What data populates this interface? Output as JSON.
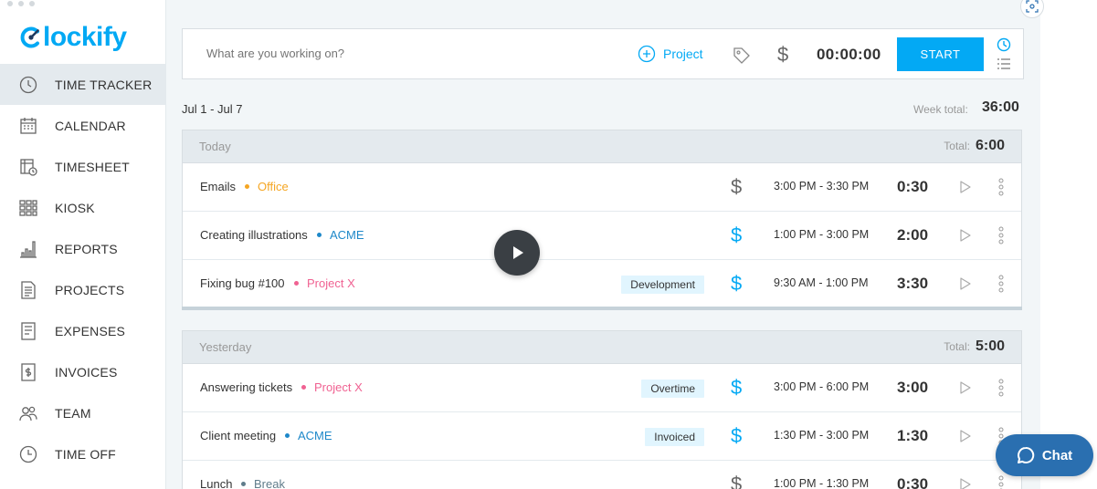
{
  "app": {
    "logo_text": "lockify",
    "brand_color": "#03a9f4"
  },
  "sidebar": {
    "items": [
      {
        "label": "TIME TRACKER",
        "icon": "clock-icon",
        "active": true
      },
      {
        "label": "CALENDAR",
        "icon": "calendar-icon",
        "active": false
      },
      {
        "label": "TIMESHEET",
        "icon": "timesheet-icon",
        "active": false
      },
      {
        "label": "KIOSK",
        "icon": "kiosk-icon",
        "active": false
      },
      {
        "label": "REPORTS",
        "icon": "reports-icon",
        "active": false
      },
      {
        "label": "PROJECTS",
        "icon": "projects-icon",
        "active": false
      },
      {
        "label": "EXPENSES",
        "icon": "expenses-icon",
        "active": false
      },
      {
        "label": "INVOICES",
        "icon": "invoices-icon",
        "active": false
      },
      {
        "label": "TEAM",
        "icon": "team-icon",
        "active": false
      },
      {
        "label": "TIME OFF",
        "icon": "time-off-icon",
        "active": false
      }
    ]
  },
  "timer": {
    "placeholder": "What are you working on?",
    "project_label": "Project",
    "display": "00:00:00",
    "start_label": "START"
  },
  "week": {
    "range": "Jul 1 - Jul 7",
    "total_label": "Week total:",
    "total_value": "36:00"
  },
  "days": [
    {
      "label": "Today",
      "total_label": "Total:",
      "total_value": "6:00",
      "entries": [
        {
          "description": "Emails",
          "project": "Office",
          "project_color": "#f5a623",
          "tag": "",
          "billable": false,
          "time_range": "3:00 PM - 3:30 PM",
          "duration": "0:30"
        },
        {
          "description": "Creating illustrations",
          "project": "ACME",
          "project_color": "#1e88c9",
          "tag": "",
          "billable": true,
          "time_range": "1:00 PM - 3:00 PM",
          "duration": "2:00"
        },
        {
          "description": "Fixing bug #100",
          "project": "Project X",
          "project_color": "#f06292",
          "tag": "Development",
          "billable": true,
          "time_range": "9:30 AM - 1:00 PM",
          "duration": "3:30"
        }
      ]
    },
    {
      "label": "Yesterday",
      "total_label": "Total:",
      "total_value": "5:00",
      "entries": [
        {
          "description": "Answering tickets",
          "project": "Project X",
          "project_color": "#f06292",
          "tag": "Overtime",
          "billable": true,
          "time_range": "3:00 PM - 6:00 PM",
          "duration": "3:00"
        },
        {
          "description": "Client meeting",
          "project": "ACME",
          "project_color": "#1e88c9",
          "tag": "Invoiced",
          "billable": true,
          "time_range": "1:30 PM - 3:00 PM",
          "duration": "1:30"
        },
        {
          "description": "Lunch",
          "project": "Break",
          "project_color": "#607d8b",
          "tag": "",
          "billable": false,
          "time_range": "1:00 PM - 1:30 PM",
          "duration": "0:30"
        }
      ]
    }
  ],
  "chat": {
    "label": "Chat",
    "color": "#2a6fb0"
  },
  "colors": {
    "billable": "#03a9f4",
    "non_billable": "#666666"
  }
}
